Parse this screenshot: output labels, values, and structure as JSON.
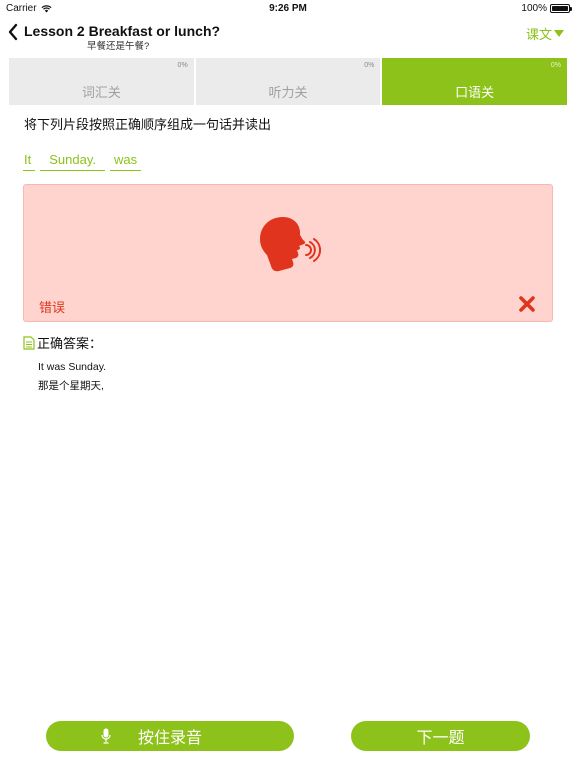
{
  "status_bar": {
    "carrier": "Carrier",
    "time": "9:26 PM",
    "battery": "100%"
  },
  "header": {
    "title": "Lesson 2 Breakfast or lunch?",
    "subtitle": "早餐还是午餐?",
    "menu_label": "课文"
  },
  "tabs": [
    {
      "label": "词汇关",
      "percent": "0%",
      "active": false
    },
    {
      "label": "听力关",
      "percent": "0%",
      "active": false
    },
    {
      "label": "口语关",
      "percent": "0%",
      "active": true
    }
  ],
  "instruction": "将下列片段按照正确顺序组成一句话并读出",
  "fragments": [
    "It",
    "Sunday.",
    "was"
  ],
  "result": {
    "label": "错误"
  },
  "answer": {
    "title": "正确答案：",
    "english": "It was Sunday.",
    "chinese": "那是个星期天,"
  },
  "buttons": {
    "record": "按住录音",
    "next": "下一题"
  },
  "colors": {
    "accent": "#8cc21a",
    "error": "#e0341e",
    "error_bg": "#ffd4ce"
  },
  "icons": {
    "back": "chevron-left-icon",
    "wifi": "wifi-icon",
    "speaker": "speaking-head-icon",
    "error": "cross-icon",
    "document": "document-icon",
    "microphone": "microphone-icon"
  }
}
